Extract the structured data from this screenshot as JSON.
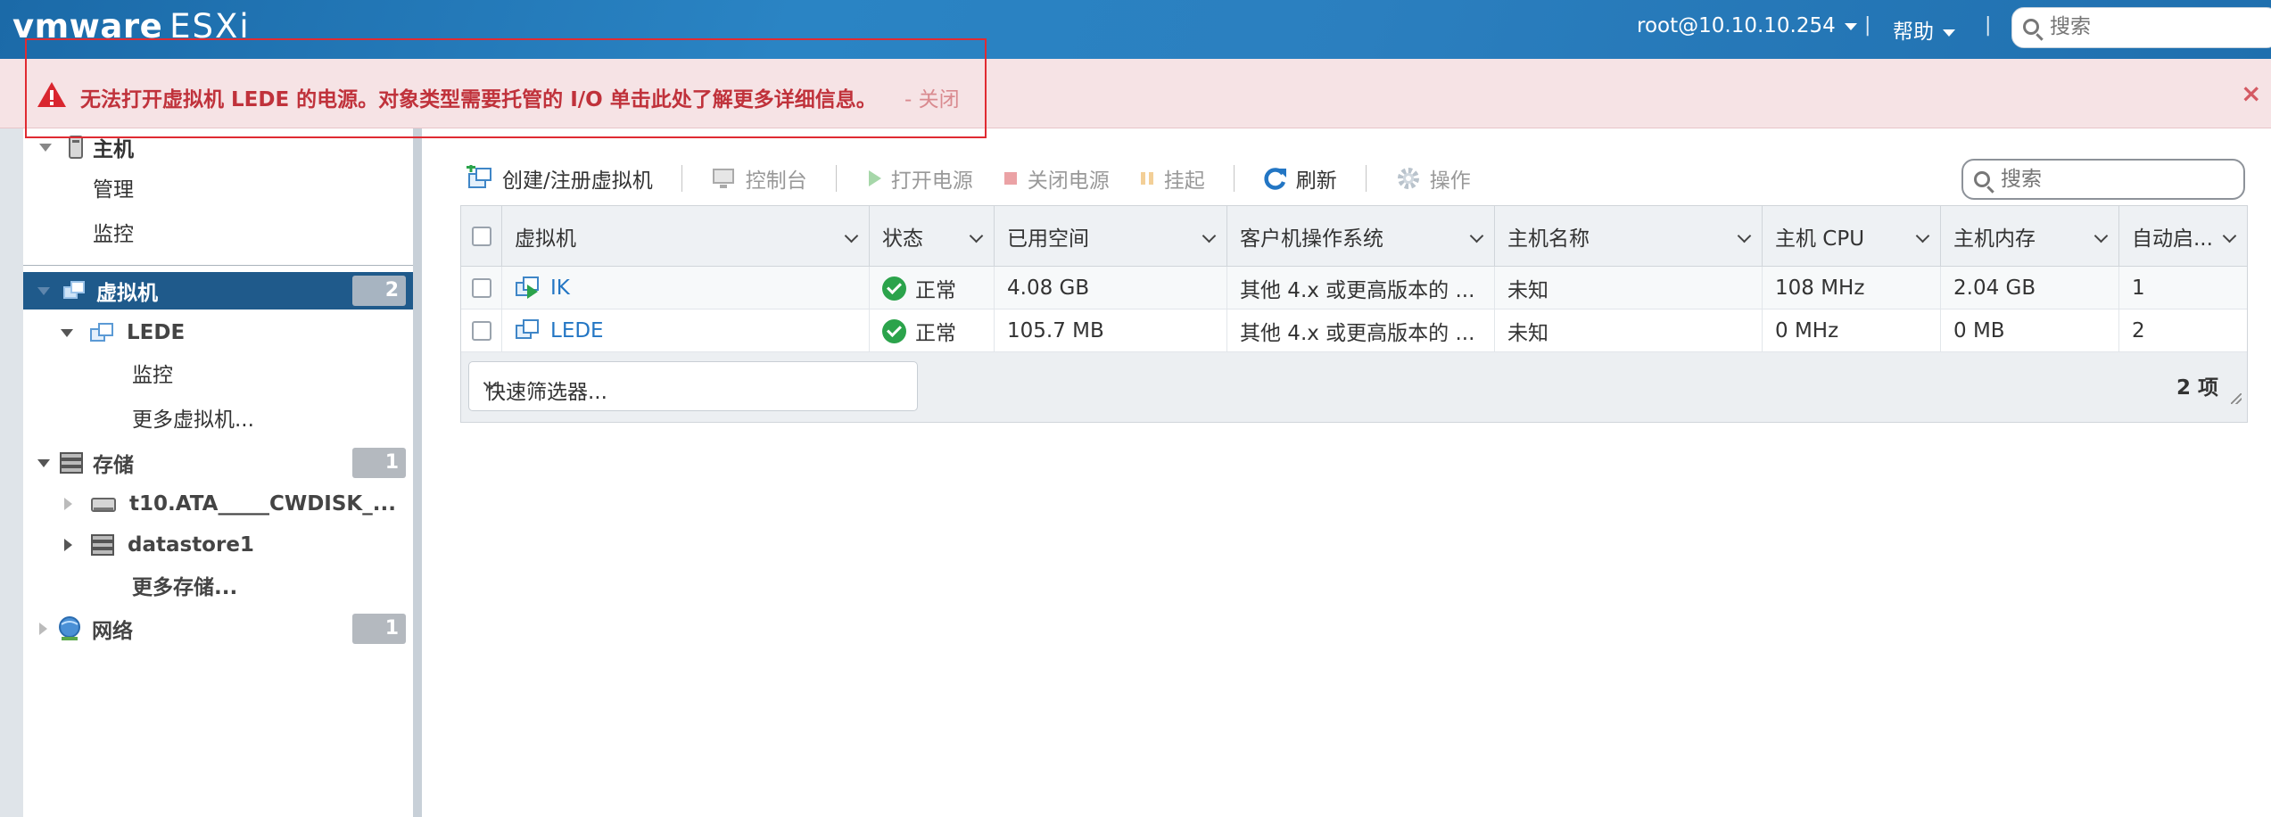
{
  "app": {
    "logo_brand": "vmware",
    "logo_product": "ESXi",
    "user": "root@10.10.10.254",
    "separator": "|",
    "help": "帮助",
    "search_placeholder": "搜索"
  },
  "alert": {
    "message": "无法打开虚拟机 LEDE 的电源。对象类型需要托管的 I/O 单击此处了解更多详细信息。",
    "close_link": "- 关闭",
    "dismiss": "×",
    "color": "#c0323b"
  },
  "sidebar": {
    "host": {
      "label": "主机",
      "children": [
        "管理",
        "监控"
      ]
    },
    "vms": {
      "label": "虚拟机",
      "badge": "2"
    },
    "vm_lede": {
      "label": "LEDE",
      "children": [
        "监控",
        "更多虚拟机..."
      ]
    },
    "storage": {
      "label": "存储",
      "badge": "1"
    },
    "storage_items": [
      "t10.ATA_____CWDISK_...",
      "datastore1",
      "更多存储..."
    ],
    "network": {
      "label": "网络",
      "badge": "1"
    }
  },
  "toolbar": {
    "create": "创建/注册虚拟机",
    "console": "控制台",
    "power_on": "打开电源",
    "power_off": "关闭电源",
    "suspend": "挂起",
    "refresh": "刷新",
    "actions": "操作",
    "search_placeholder": "搜索"
  },
  "grid": {
    "columns": [
      "虚拟机",
      "状态",
      "已用空间",
      "客户机操作系统",
      "主机名称",
      "主机 CPU",
      "主机内存",
      "自动启..."
    ],
    "rows": [
      {
        "name": "IK",
        "status": "正常",
        "used": "4.08 GB",
        "os": "其他 4.x 或更高版本的 ...",
        "host": "未知",
        "cpu": "108 MHz",
        "mem": "2.04 GB",
        "autostart": "1"
      },
      {
        "name": "LEDE",
        "status": "正常",
        "used": "105.7 MB",
        "os": "其他 4.x 或更高版本的 ...",
        "host": "未知",
        "cpu": "0 MHz",
        "mem": "0 MB",
        "autostart": "2"
      }
    ],
    "filter_placeholder": "快速筛选器...",
    "count": "2 项"
  }
}
